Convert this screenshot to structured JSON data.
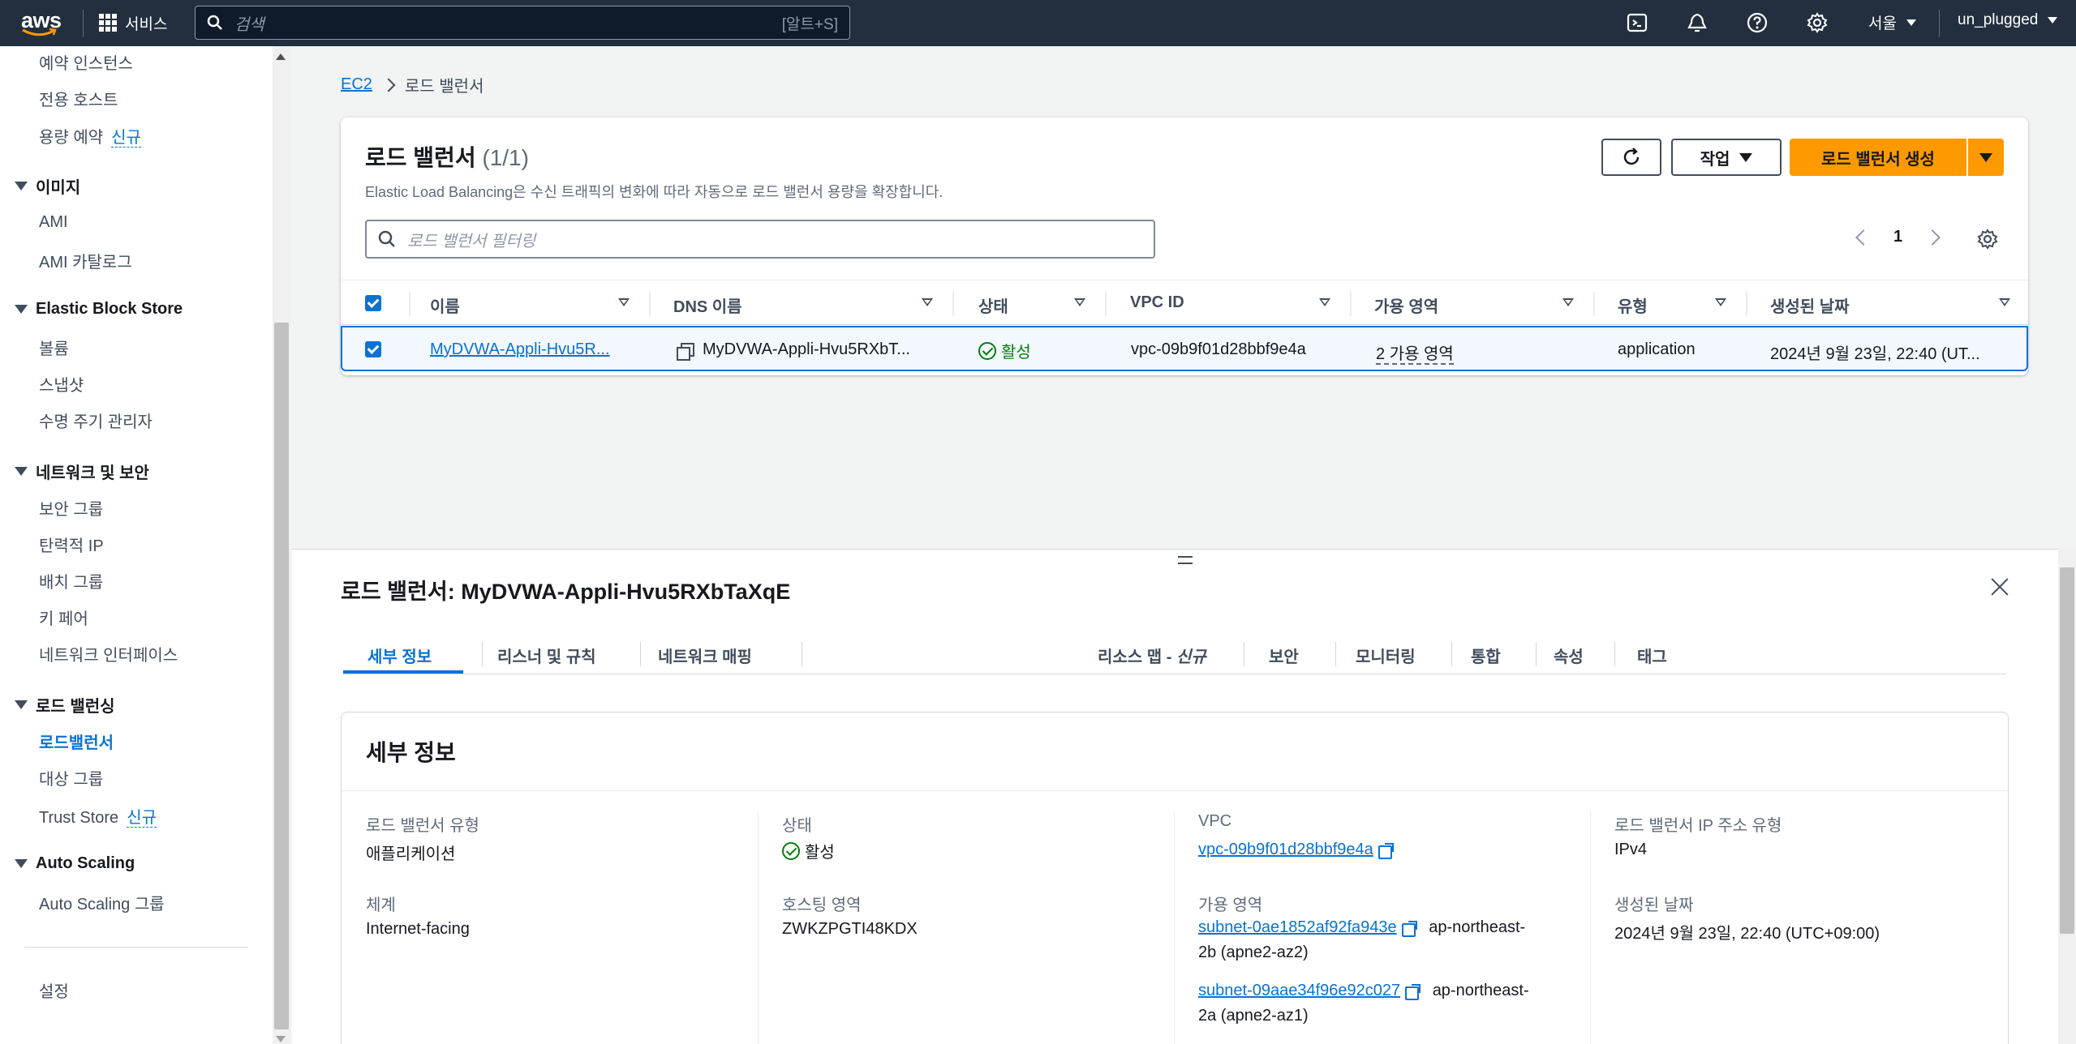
{
  "topnav": {
    "logo": "aws",
    "services_label": "서비스",
    "search_placeholder": "검색",
    "search_hint": "[알트+S]",
    "region": "서울",
    "user": "un_plugged"
  },
  "sidebar": {
    "items_top": [
      "예약 인스턴스",
      "전용 호스트",
      "용량 예약"
    ],
    "capacity_badge": "신규",
    "sections": {
      "images": {
        "title": "이미지",
        "items": [
          "AMI",
          "AMI 카탈로그"
        ]
      },
      "ebs": {
        "title": "Elastic Block Store",
        "items": [
          "볼륨",
          "스냅샷",
          "수명 주기 관리자"
        ]
      },
      "network": {
        "title": "네트워크 및 보안",
        "items": [
          "보안 그룹",
          "탄력적 IP",
          "배치 그룹",
          "키 페어",
          "네트워크 인터페이스"
        ]
      },
      "lb": {
        "title": "로드 밸런싱",
        "items": [
          "로드밸런서",
          "대상 그룹",
          "Trust Store"
        ],
        "trust_badge": "신규"
      },
      "autoscaling": {
        "title": "Auto Scaling",
        "items": [
          "Auto Scaling 그룹"
        ]
      }
    },
    "settings": "설정"
  },
  "breadcrumb": {
    "root": "EC2",
    "current": "로드 밸런서"
  },
  "lb_panel": {
    "title": "로드 밸런서",
    "count": "(1/1)",
    "description": "Elastic Load Balancing은 수신 트래픽의 변화에 따라 자동으로 로드 밸런서 용량을 확장합니다.",
    "action_label": "작업",
    "create_label": "로드 밸런서 생성",
    "filter_placeholder": "로드 밸런서 필터링",
    "page": "1",
    "columns": [
      "이름",
      "DNS 이름",
      "상태",
      "VPC ID",
      "가용 영역",
      "유형",
      "생성된 날짜"
    ],
    "row": {
      "name": "MyDVWA-Appli-Hvu5R...",
      "dns": "MyDVWA-Appli-Hvu5RXbT...",
      "status": "활성",
      "vpc": "vpc-09b9f01d28bbf9e4a",
      "az": "2 가용 영역",
      "type": "application",
      "created": "2024년 9월 23일, 22:40 (UT..."
    }
  },
  "split": {
    "title": "로드 밸런서: MyDVWA-Appli-Hvu5RXbTaXqE",
    "tabs": [
      "세부 정보",
      "리스너 및 규칙",
      "네트워크 매핑",
      "리소스 맵 - ",
      "보안",
      "모니터링",
      "통합",
      "속성",
      "태그"
    ],
    "tab_new": "신규",
    "details": {
      "title": "세부 정보",
      "lb_type_label": "로드 밸런서 유형",
      "lb_type": "애플리케이션",
      "scheme_label": "체계",
      "scheme": "Internet-facing",
      "status_label": "상태",
      "status": "활성",
      "hosted_zone_label": "호스팅 영역",
      "hosted_zone": "ZWKZPGTI48KDX",
      "vpc_label": "VPC",
      "vpc": "vpc-09b9f01d28bbf9e4a",
      "az_label": "가용 영역",
      "subnet1": "subnet-0ae1852af92fa943e",
      "subnet1_az_a": "ap-northeast-",
      "subnet1_az_b": "2b (apne2-az2)",
      "subnet2": "subnet-09aae34f96e92c027",
      "subnet2_az_a": "ap-northeast-",
      "subnet2_az_b": "2a (apne2-az1)",
      "ip_type_label": "로드 밸런서 IP 주소 유형",
      "ip_type": "IPv4",
      "created_label": "생성된 날짜",
      "created": "2024년 9월 23일, 22:40 (UTC+09:00)"
    }
  },
  "colors": {
    "nav": "#232f3e",
    "primary": "#ff9900",
    "link": "#0972d3",
    "success": "#037f0c"
  }
}
